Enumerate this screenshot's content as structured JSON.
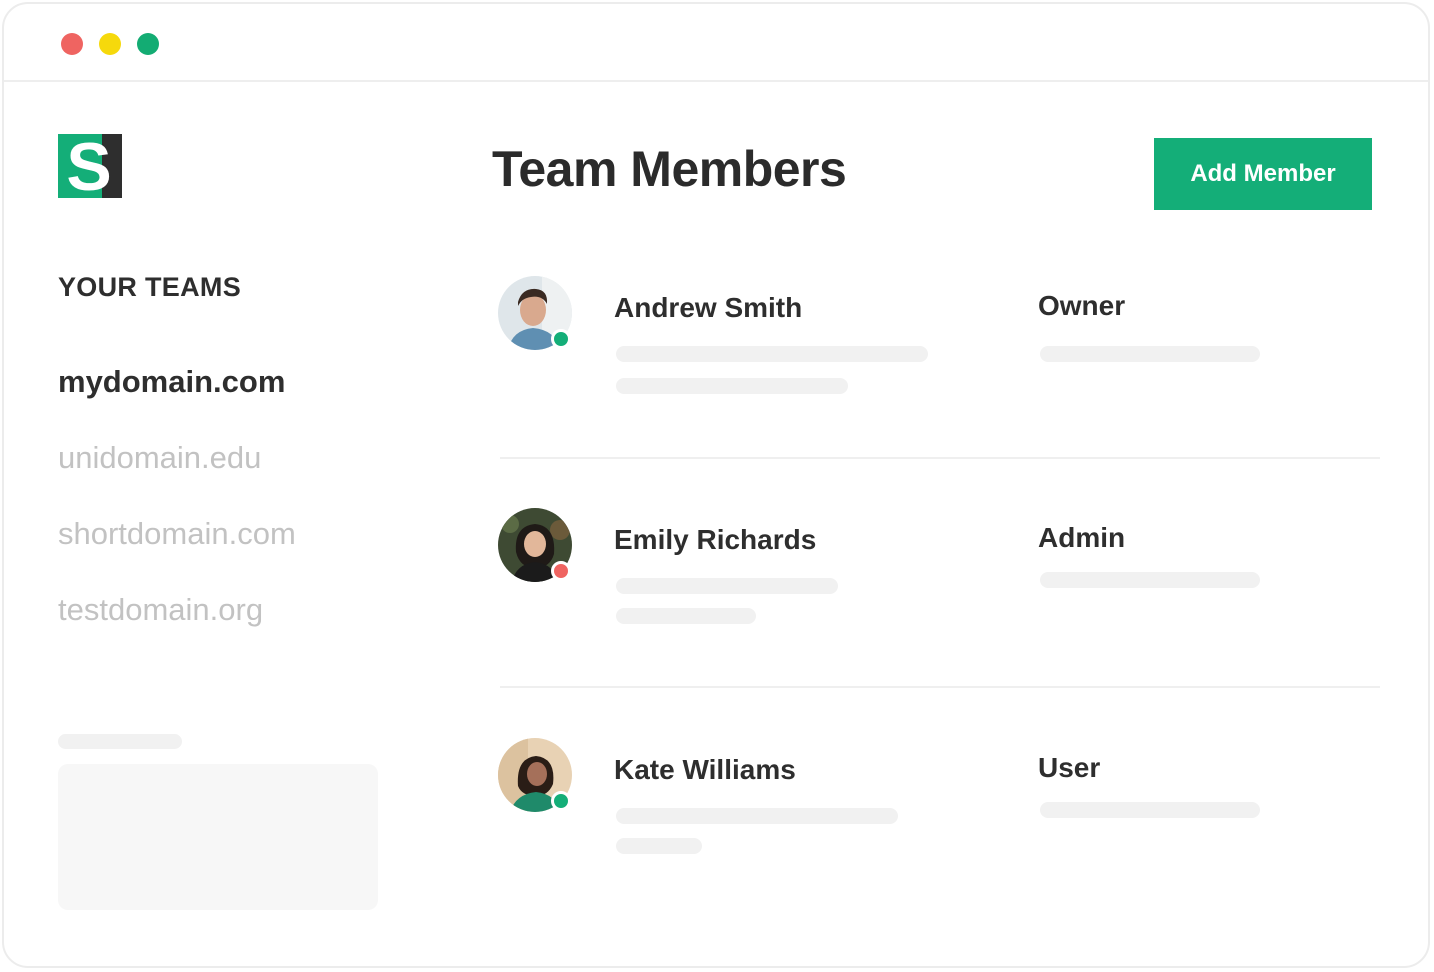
{
  "window": {
    "controls": [
      "close",
      "minimize",
      "maximize"
    ],
    "control_colors": {
      "close": "#ef6461",
      "minimize": "#f6d90c",
      "maximize": "#13ac73"
    }
  },
  "brand": {
    "logo_letter": "S",
    "colors": {
      "green": "#14ae78",
      "dark": "#2e2e2e"
    }
  },
  "sidebar": {
    "heading": "YOUR TEAMS",
    "teams": [
      {
        "label": "mydomain.com",
        "active": true
      },
      {
        "label": "unidomain.edu",
        "active": false
      },
      {
        "label": "shortdomain.com",
        "active": false
      },
      {
        "label": "testdomain.org",
        "active": false
      }
    ]
  },
  "main": {
    "title": "Team Members",
    "add_button_label": "Add Member",
    "members": [
      {
        "name": "Andrew Smith",
        "role": "Owner",
        "status": "online",
        "status_color": "#14ae78"
      },
      {
        "name": "Emily Richards",
        "role": "Admin",
        "status": "offline",
        "status_color": "#ef6461"
      },
      {
        "name": "Kate Williams",
        "role": "User",
        "status": "online",
        "status_color": "#14ae78"
      }
    ]
  }
}
